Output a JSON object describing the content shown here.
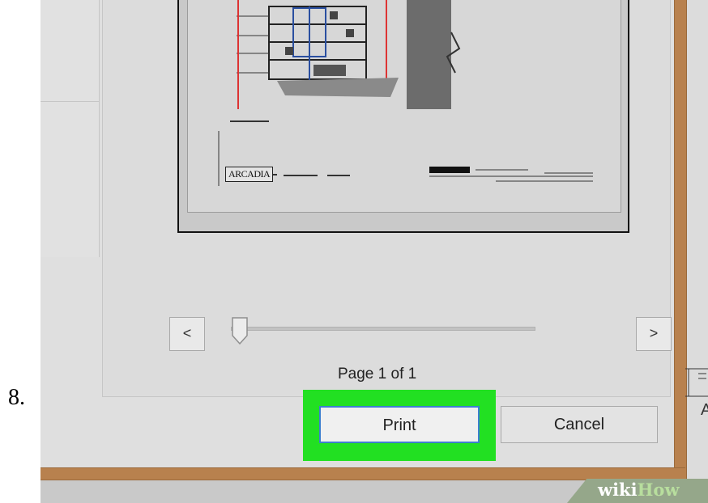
{
  "step": {
    "number": "8."
  },
  "drawing": {
    "logo_text": "ARCADIA"
  },
  "navigation": {
    "prev_label": "<",
    "next_label": ">",
    "page_slider_value": 1
  },
  "status": {
    "page_count": "Page 1 of 1"
  },
  "actions": {
    "print_label": "Print",
    "cancel_label": "Cancel"
  },
  "annotation": {
    "letter": "A"
  },
  "watermark": {
    "wiki": "wiki",
    "how": "How"
  },
  "colors": {
    "highlight": "#22e022",
    "window_frame": "#b8814e",
    "print_focus_border": "#3d7fd0"
  }
}
